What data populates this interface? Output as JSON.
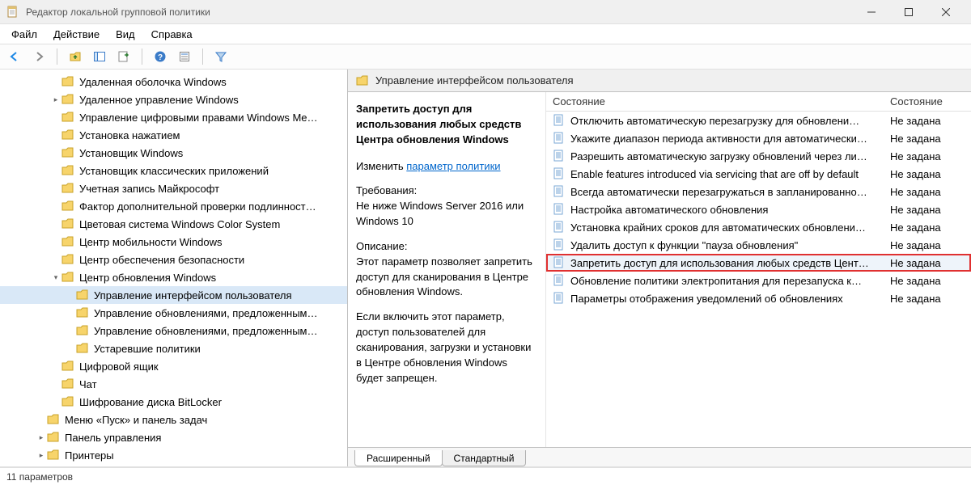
{
  "window": {
    "title": "Редактор локальной групповой политики"
  },
  "menubar": {
    "items": [
      "Файл",
      "Действие",
      "Вид",
      "Справка"
    ]
  },
  "tree": [
    {
      "indent": 3,
      "twist": "",
      "label": "Удаленная оболочка Windows"
    },
    {
      "indent": 3,
      "twist": ">",
      "label": "Удаленное управление Windows"
    },
    {
      "indent": 3,
      "twist": "",
      "label": "Управление цифровыми правами Windows Me…"
    },
    {
      "indent": 3,
      "twist": "",
      "label": "Установка нажатием"
    },
    {
      "indent": 3,
      "twist": "",
      "label": "Установщик Windows"
    },
    {
      "indent": 3,
      "twist": "",
      "label": "Установщик классических приложений"
    },
    {
      "indent": 3,
      "twist": "",
      "label": "Учетная запись Майкрософт"
    },
    {
      "indent": 3,
      "twist": "",
      "label": "Фактор дополнительной проверки подлинност…"
    },
    {
      "indent": 3,
      "twist": "",
      "label": "Цветовая система Windows Color System"
    },
    {
      "indent": 3,
      "twist": "",
      "label": "Центр мобильности Windows"
    },
    {
      "indent": 3,
      "twist": "",
      "label": "Центр обеспечения безопасности"
    },
    {
      "indent": 3,
      "twist": "v",
      "label": "Центр обновления Windows"
    },
    {
      "indent": 4,
      "twist": "",
      "label": "Управление интерфейсом пользователя",
      "selected": true
    },
    {
      "indent": 4,
      "twist": "",
      "label": "Управление обновлениями, предложенным…"
    },
    {
      "indent": 4,
      "twist": "",
      "label": "Управление обновлениями, предложенным…"
    },
    {
      "indent": 4,
      "twist": "",
      "label": "Устаревшие политики"
    },
    {
      "indent": 3,
      "twist": "",
      "label": "Цифровой ящик"
    },
    {
      "indent": 3,
      "twist": "",
      "label": "Чат"
    },
    {
      "indent": 3,
      "twist": "",
      "label": "Шифрование диска BitLocker"
    },
    {
      "indent": 2,
      "twist": "",
      "label": "Меню «Пуск» и панель задач"
    },
    {
      "indent": 2,
      "twist": ">",
      "label": "Панель управления"
    },
    {
      "indent": 2,
      "twist": ">",
      "label": "Принтеры"
    }
  ],
  "right": {
    "header": "Управление интерфейсом пользователя",
    "detail": {
      "title": "Запретить доступ для использования любых средств Центра обновления Windows",
      "edit_label": "Изменить",
      "edit_link": "параметр политики",
      "req_label": "Требования:",
      "req_text": "Не ниже Windows Server 2016 или Windows 10",
      "desc_label": "Описание:",
      "desc1": "Этот параметр позволяет запретить доступ для сканирования в Центре обновления Windows.",
      "desc2": "Если включить этот параметр, доступ пользователей для сканирования, загрузки и установки в Центре обновления Windows будет запрещен."
    },
    "columns": {
      "state": "Состояние",
      "state2": "Состояние"
    },
    "policies": [
      {
        "name": "Отключить автоматическую перезагрузку для обновлени…",
        "state": "Не задана"
      },
      {
        "name": "Укажите диапазон периода активности для автоматически…",
        "state": "Не задана"
      },
      {
        "name": "Разрешить автоматическую загрузку обновлений через ли…",
        "state": "Не задана"
      },
      {
        "name": "Enable features introduced via servicing that are off by default",
        "state": "Не задана"
      },
      {
        "name": "Всегда автоматически перезагружаться в запланированно…",
        "state": "Не задана"
      },
      {
        "name": "Настройка автоматического обновления",
        "state": "Не задана"
      },
      {
        "name": "Установка крайних сроков для автоматических обновлени…",
        "state": "Не задана"
      },
      {
        "name": "Удалить доступ к функции \"пауза обновления\"",
        "state": "Не задана"
      },
      {
        "name": "Запретить доступ для использования любых средств Цент…",
        "state": "Не задана",
        "highlighted": true
      },
      {
        "name": "Обновление политики электропитания для перезапуска к…",
        "state": "Не задана"
      },
      {
        "name": "Параметры отображения уведомлений об обновлениях",
        "state": "Не задана"
      }
    ],
    "tabs": {
      "extended": "Расширенный",
      "standard": "Стандартный"
    }
  },
  "statusbar": {
    "text": "11 параметров"
  }
}
